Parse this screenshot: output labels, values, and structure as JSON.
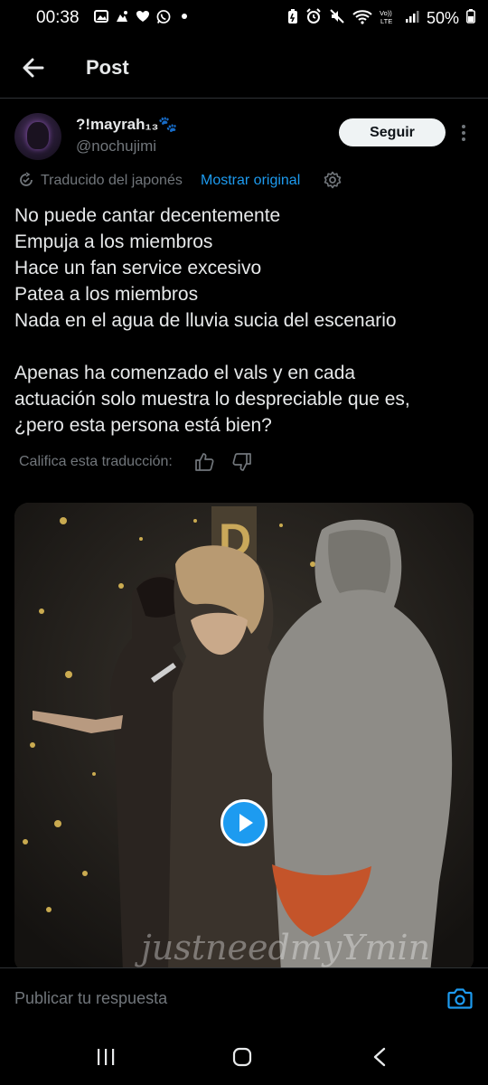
{
  "status_bar": {
    "time": "00:38",
    "battery": "50%",
    "left_icons": [
      "gallery-icon",
      "notification-icon",
      "heart-icon",
      "whatsapp-icon",
      "dot-icon"
    ],
    "right_icons": [
      "battery-saver-icon",
      "alarm-icon",
      "mute-icon",
      "wifi-icon",
      "volte-icon",
      "signal-icon",
      "battery-icon"
    ]
  },
  "header": {
    "title": "Post"
  },
  "author": {
    "name": "?!mayrah₁₃🐾",
    "handle": "@nochujimi",
    "follow_label": "Seguir"
  },
  "translation": {
    "label": "Traducido del japonés",
    "show_original": "Mostrar original"
  },
  "post": {
    "lines": [
      "No puede cantar decentemente",
      "Empuja a los miembros",
      "Hace un fan service excesivo",
      "Patea a los miembros",
      "Nada en el agua de lluvia sucia del escenario"
    ],
    "paragraph2_lines": [
      "Apenas ha comenzado el vals y en cada",
      "actuación solo muestra lo despreciable que es,",
      "¿pero esta persona está bien?"
    ]
  },
  "rate": {
    "label": "Califica esta traducción:"
  },
  "media": {
    "watermark": "justneedmyYmin"
  },
  "reply": {
    "placeholder": "Publicar tu respuesta"
  },
  "colors": {
    "accent": "#1d9bf0",
    "background": "#000000",
    "muted": "#71767b",
    "text": "#e7e9ea"
  }
}
